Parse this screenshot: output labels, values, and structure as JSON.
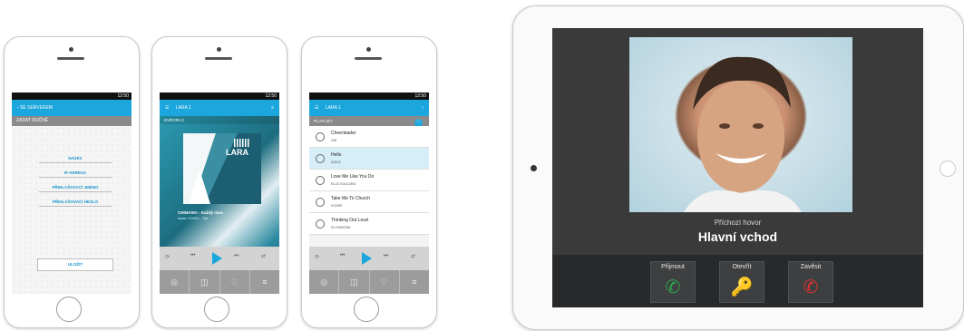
{
  "phone1": {
    "time": "12:50",
    "back_label": "SE SERVEREM",
    "subheader": "ZADAT RUČNĚ",
    "fields": [
      "NÁZEV",
      "IP ADRESA",
      "PŘIHLAŠOVACÍ JMÉNO",
      "PŘIHLAŠOVACÍ HESLO"
    ],
    "save_label": "ULOŽIT"
  },
  "phone2": {
    "time": "12:50",
    "title": "LARA 1",
    "station": "EVROPA 2",
    "album_logo": "LARA",
    "song": "CHINASKI - Každý ráno",
    "artist": "Insko: VOXEL - Trip"
  },
  "phone3": {
    "time": "12:50",
    "title": "LARA 1",
    "section": "PLAYLIST",
    "tracks": [
      {
        "title": "Cheerleader",
        "artist": "OMI"
      },
      {
        "title": "Hello",
        "artist": "ADELE"
      },
      {
        "title": "Love Me Like You Do",
        "artist": "ELLIE GOULDING"
      },
      {
        "title": "Take Me To Church",
        "artist": "HOZIER"
      },
      {
        "title": "Thinking Out Loud",
        "artist": "ED SHEERAN"
      }
    ]
  },
  "tablet": {
    "caller_subtitle": "Příchozí hovor",
    "caller_name": "Hlavní vchod",
    "buttons": [
      {
        "label": "Přijmout",
        "icon": "phone-accept-icon",
        "color": "#2fa84f"
      },
      {
        "label": "Otevřít",
        "icon": "key-icon",
        "color": "#cfcfcf"
      },
      {
        "label": "Zavěsit",
        "icon": "phone-hangup-icon",
        "color": "#e03232"
      }
    ]
  },
  "colors": {
    "accent": "#1ba6dd",
    "tablet_bg": "#3a3a3b"
  }
}
